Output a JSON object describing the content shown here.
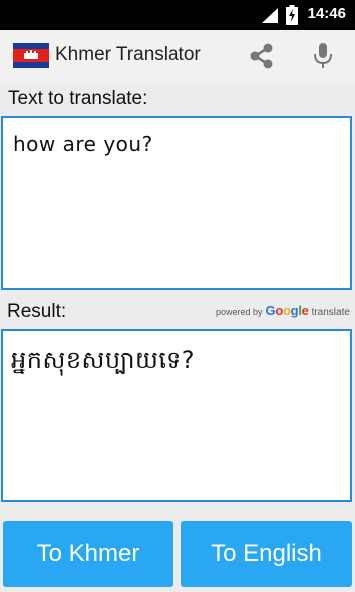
{
  "status_bar": {
    "time": "14:46",
    "icons": [
      "signal-icon",
      "battery-charging-icon"
    ]
  },
  "app_bar": {
    "title": "Khmer Translator",
    "icons": [
      "cambodia-flag-icon",
      "share-icon",
      "microphone-icon"
    ]
  },
  "input": {
    "label": "Text to translate:",
    "value": "how are you?"
  },
  "result": {
    "label": "Result:",
    "value": "អ្នកសុខសប្បាយទេ?",
    "powered_by": {
      "prefix": "powered by",
      "google": [
        "G",
        "o",
        "o",
        "g",
        "l",
        "e"
      ],
      "google_colors": [
        "#3b6fd6",
        "#d53a2e",
        "#e8b21a",
        "#3b6fd6",
        "#3aa34a",
        "#d53a2e"
      ],
      "suffix": "translate"
    }
  },
  "buttons": {
    "to_khmer": "To Khmer",
    "to_english": "To English"
  },
  "colors": {
    "accent": "#2a8ad4",
    "button": "#29a7f2",
    "flag_blue": "#1a3a9a",
    "flag_red": "#e0221c"
  }
}
